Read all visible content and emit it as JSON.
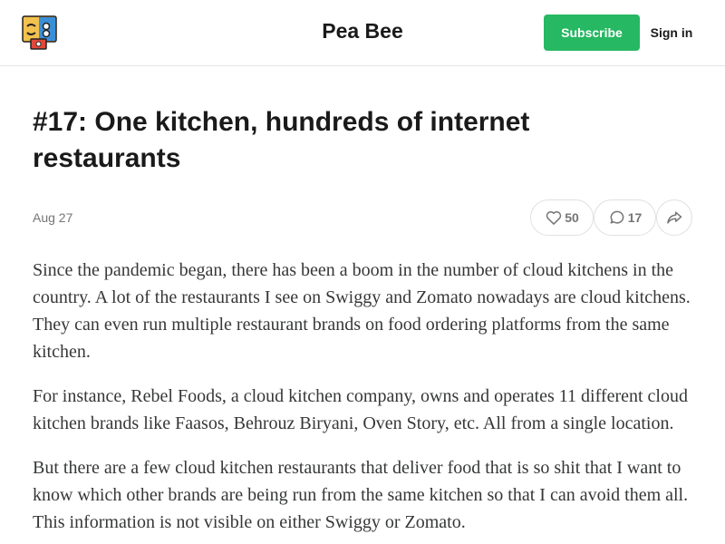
{
  "header": {
    "publication_name": "Pea Bee",
    "subscribe_label": "Subscribe",
    "signin_label": "Sign in",
    "logo_icon": "publication-logo-icon",
    "accent_color": "#26b862"
  },
  "post": {
    "title": "#17: One kitchen, hundreds of internet restaurants",
    "date": "Aug 27",
    "likes": "50",
    "comments": "17",
    "like_icon": "heart-icon",
    "comment_icon": "speech-bubble-icon",
    "share_icon": "share-arrow-icon",
    "paragraphs": [
      "Since the pandemic began, there has been a boom in the number of cloud kitchens in the country. A lot of the restaurants I see on Swiggy and Zomato nowadays are cloud kitchens. They can even run multiple restaurant brands on food ordering platforms from the same kitchen.",
      "For instance, Rebel Foods, a cloud kitchen company, owns and operates 11 different cloud kitchen brands like Faasos, Behrouz Biryani, Oven Story, etc. All from a single location.",
      "But there are a few cloud kitchen restaurants that deliver food that is so shit that I want to know which other brands are being run from the same kitchen so that I can avoid them all. This information is not visible on either Swiggy or Zomato."
    ]
  }
}
